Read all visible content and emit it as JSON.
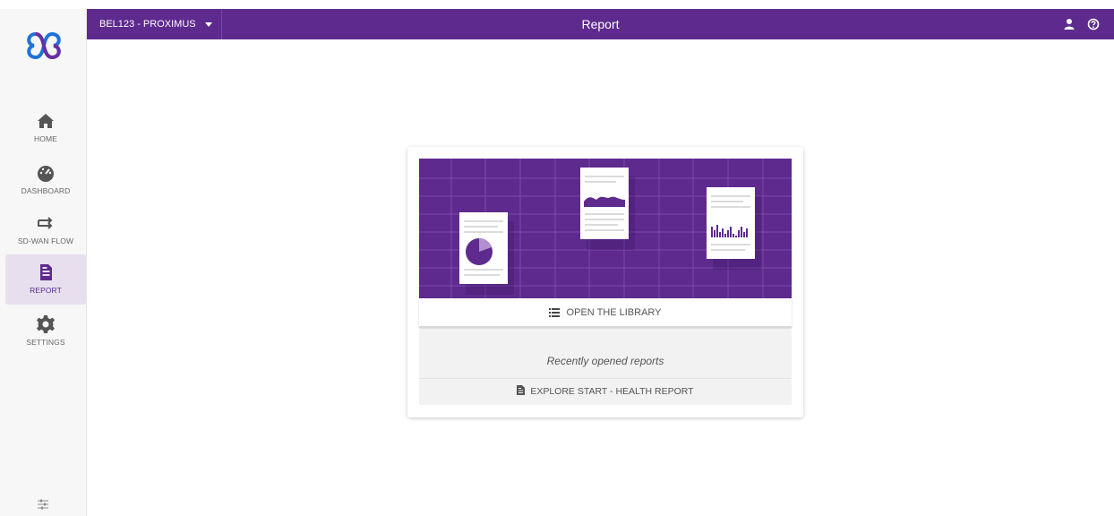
{
  "header": {
    "tenant": "BEL123 - PROXIMUS",
    "title": "Report",
    "icons": [
      "user-icon",
      "help-icon"
    ]
  },
  "sidebar": {
    "items": [
      {
        "label": "HOME",
        "icon": "home-icon"
      },
      {
        "label": "DASHBOARD",
        "icon": "gauge-icon"
      },
      {
        "label": "SD-WAN FLOW",
        "icon": "flow-arrows-icon"
      },
      {
        "label": "REPORT",
        "icon": "report-icon",
        "active": true
      },
      {
        "label": "SETTINGS",
        "icon": "gear-icon"
      }
    ],
    "bottom_icon": "sliders-icon"
  },
  "card": {
    "library_button": "OPEN THE LIBRARY",
    "recent_title": "Recently opened reports",
    "recent_items": [
      "EXPLORE START - HEALTH REPORT"
    ]
  },
  "colors": {
    "brand": "#5e2a8e",
    "active_bg": "#e7dfee",
    "logo_blue": "#1e73d8",
    "logo_purple": "#6b2ea0"
  }
}
